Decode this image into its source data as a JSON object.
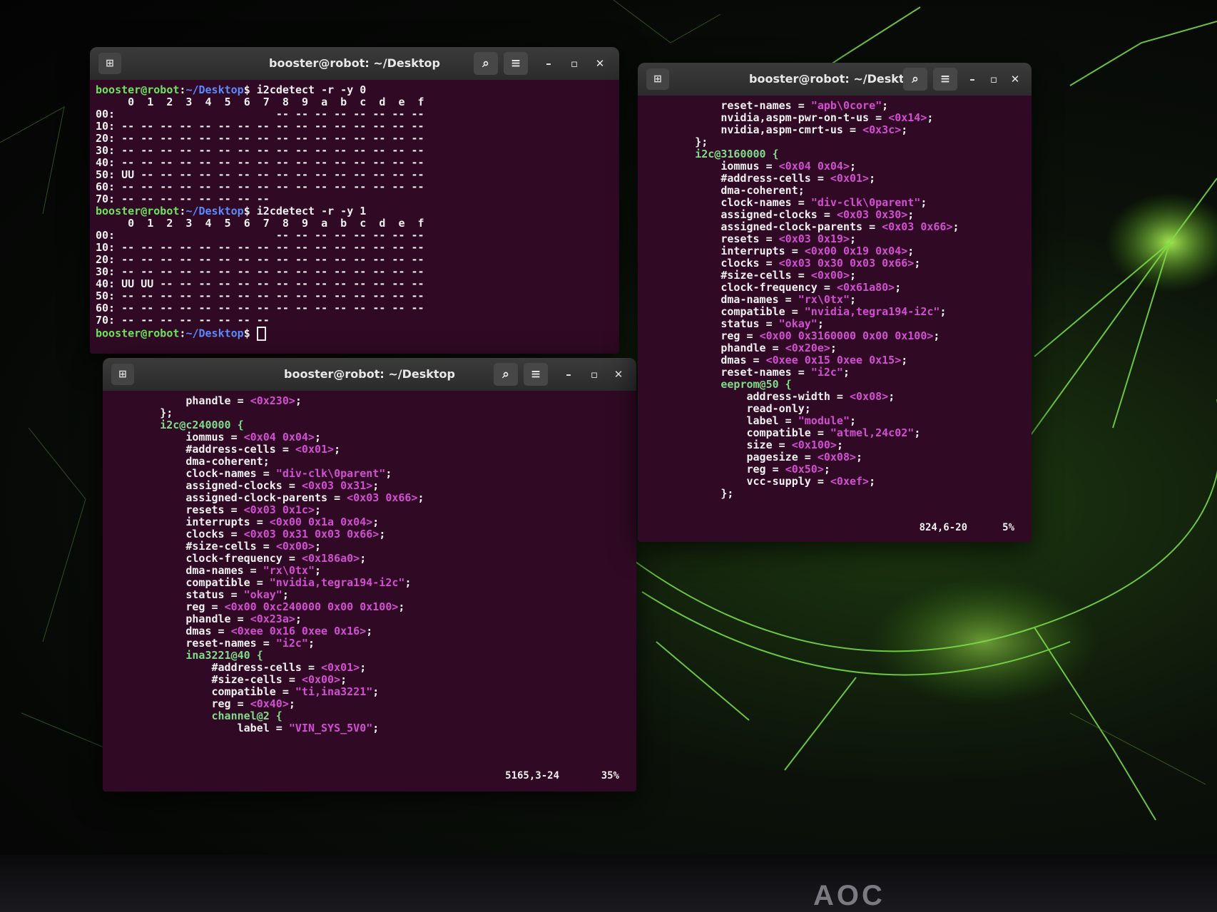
{
  "window_title": "booster@robot: ~/Desktop",
  "prompt": {
    "user": "booster@robot",
    "path": "~/Desktop"
  },
  "term1": {
    "cmd1": "i2cdetect -r -y 0",
    "bus0_lines": [
      "     0  1  2  3  4  5  6  7  8  9  a  b  c  d  e  f",
      "00:                         -- -- -- -- -- -- -- --",
      "10: -- -- -- -- -- -- -- -- -- -- -- -- -- -- -- --",
      "20: -- -- -- -- -- -- -- -- -- -- -- -- -- -- -- --",
      "30: -- -- -- -- -- -- -- -- -- -- -- -- -- -- -- --",
      "40: -- -- -- -- -- -- -- -- -- -- -- -- -- -- -- --",
      "50: UU -- -- -- -- -- -- -- -- -- -- -- -- -- -- --",
      "60: -- -- -- -- -- -- -- -- -- -- -- -- -- -- -- --",
      "70: -- -- -- -- -- -- -- --"
    ],
    "cmd2": "i2cdetect -r -y 1",
    "bus1_lines": [
      "     0  1  2  3  4  5  6  7  8  9  a  b  c  d  e  f",
      "00:                         -- -- -- -- -- -- -- --",
      "10: -- -- -- -- -- -- -- -- -- -- -- -- -- -- -- --",
      "20: -- -- -- -- -- -- -- -- -- -- -- -- -- -- -- --",
      "30: -- -- -- -- -- -- -- -- -- -- -- -- -- -- -- --",
      "40: UU UU -- -- -- -- -- -- -- -- -- -- -- -- -- --",
      "50: -- -- -- -- -- -- -- -- -- -- -- -- -- -- -- --",
      "60: -- -- -- -- -- -- -- -- -- -- -- -- -- -- -- --",
      "70: -- -- -- -- -- -- -- --"
    ]
  },
  "term2": {
    "lines": [
      {
        "i": 6,
        "k": "phandle = ",
        "v": "<0x230>",
        "e": ";"
      },
      {
        "i": 4,
        "k": "};",
        "v": "",
        "e": ""
      },
      {
        "i": 0,
        "k": "",
        "v": "",
        "e": ""
      },
      {
        "i": 4,
        "k": "i2c@c240000 {",
        "v": "",
        "e": "",
        "node": true
      },
      {
        "i": 6,
        "k": "iommus = ",
        "v": "<0x04 0x04>",
        "e": ";"
      },
      {
        "i": 6,
        "k": "#address-cells = ",
        "v": "<0x01>",
        "e": ";"
      },
      {
        "i": 6,
        "k": "dma-coherent;",
        "v": "",
        "e": ""
      },
      {
        "i": 6,
        "k": "clock-names = ",
        "v": "\"div-clk\\0parent\"",
        "e": ";"
      },
      {
        "i": 6,
        "k": "assigned-clocks = ",
        "v": "<0x03 0x31>",
        "e": ";"
      },
      {
        "i": 6,
        "k": "assigned-clock-parents = ",
        "v": "<0x03 0x66>",
        "e": ";"
      },
      {
        "i": 6,
        "k": "resets = ",
        "v": "<0x03 0x1c>",
        "e": ";"
      },
      {
        "i": 6,
        "k": "interrupts = ",
        "v": "<0x00 0x1a 0x04>",
        "e": ";"
      },
      {
        "i": 6,
        "k": "clocks = ",
        "v": "<0x03 0x31 0x03 0x66>",
        "e": ";"
      },
      {
        "i": 6,
        "k": "#size-cells = ",
        "v": "<0x00>",
        "e": ";"
      },
      {
        "i": 6,
        "k": "clock-frequency = ",
        "v": "<0x186a0>",
        "e": ";"
      },
      {
        "i": 6,
        "k": "dma-names = ",
        "v": "\"rx\\0tx\"",
        "e": ";"
      },
      {
        "i": 6,
        "k": "compatible = ",
        "v": "\"nvidia,tegra194-i2c\"",
        "e": ";"
      },
      {
        "i": 6,
        "k": "status = ",
        "v": "\"okay\"",
        "e": ";"
      },
      {
        "i": 6,
        "k": "reg = ",
        "v": "<0x00 0xc240000 0x00 0x100>",
        "e": ";"
      },
      {
        "i": 6,
        "k": "phandle = ",
        "v": "<0x23a>",
        "e": ";"
      },
      {
        "i": 6,
        "k": "dmas = ",
        "v": "<0xee 0x16 0xee 0x16>",
        "e": ";"
      },
      {
        "i": 6,
        "k": "reset-names = ",
        "v": "\"i2c\"",
        "e": ";"
      },
      {
        "i": 0,
        "k": "",
        "v": "",
        "e": ""
      },
      {
        "i": 6,
        "k": "ina3221@40 {",
        "v": "",
        "e": "",
        "node": true
      },
      {
        "i": 8,
        "k": "#address-cells = ",
        "v": "<0x01>",
        "e": ";"
      },
      {
        "i": 8,
        "k": "#size-cells = ",
        "v": "<0x00>",
        "e": ";"
      },
      {
        "i": 8,
        "k": "compatible = ",
        "v": "\"ti,ina3221\"",
        "e": ";"
      },
      {
        "i": 8,
        "k": "reg = ",
        "v": "<0x40>",
        "e": ";"
      },
      {
        "i": 0,
        "k": "",
        "v": "",
        "e": ""
      },
      {
        "i": 8,
        "k": "channel@2 {",
        "v": "",
        "e": "",
        "node": true
      },
      {
        "i": 10,
        "k": "label = ",
        "v": "\"VIN_SYS_5V0\"",
        "e": ";"
      }
    ],
    "status_pos": "5165,3-24",
    "status_pct": "35%"
  },
  "term3": {
    "lines": [
      {
        "i": 6,
        "k": "reset-names = ",
        "v": "\"apb\\0core\"",
        "e": ";"
      },
      {
        "i": 6,
        "k": "nvidia,aspm-pwr-on-t-us = ",
        "v": "<0x14>",
        "e": ";"
      },
      {
        "i": 6,
        "k": "nvidia,aspm-cmrt-us = ",
        "v": "<0x3c>",
        "e": ";"
      },
      {
        "i": 4,
        "k": "};",
        "v": "",
        "e": ""
      },
      {
        "i": 0,
        "k": "",
        "v": "",
        "e": ""
      },
      {
        "i": 4,
        "k": "i2c@3160000 {",
        "v": "",
        "e": "",
        "node": true
      },
      {
        "i": 6,
        "k": "iommus = ",
        "v": "<0x04 0x04>",
        "e": ";"
      },
      {
        "i": 6,
        "k": "#address-cells = ",
        "v": "<0x01>",
        "e": ";"
      },
      {
        "i": 6,
        "k": "dma-coherent;",
        "v": "",
        "e": ""
      },
      {
        "i": 6,
        "k": "clock-names = ",
        "v": "\"div-clk\\0parent\"",
        "e": ";"
      },
      {
        "i": 6,
        "k": "assigned-clocks = ",
        "v": "<0x03 0x30>",
        "e": ";"
      },
      {
        "i": 6,
        "k": "assigned-clock-parents = ",
        "v": "<0x03 0x66>",
        "e": ";"
      },
      {
        "i": 6,
        "k": "resets = ",
        "v": "<0x03 0x19>",
        "e": ";"
      },
      {
        "i": 6,
        "k": "interrupts = ",
        "v": "<0x00 0x19 0x04>",
        "e": ";"
      },
      {
        "i": 6,
        "k": "clocks = ",
        "v": "<0x03 0x30 0x03 0x66>",
        "e": ";"
      },
      {
        "i": 6,
        "k": "#size-cells = ",
        "v": "<0x00>",
        "e": ";"
      },
      {
        "i": 6,
        "k": "clock-frequency = ",
        "v": "<0x61a80>",
        "e": ";"
      },
      {
        "i": 6,
        "k": "dma-names = ",
        "v": "\"rx\\0tx\"",
        "e": ";"
      },
      {
        "i": 6,
        "k": "compatible = ",
        "v": "\"nvidia,tegra194-i2c\"",
        "e": ";"
      },
      {
        "i": 6,
        "k": "status = ",
        "v": "\"okay\"",
        "e": ";"
      },
      {
        "i": 6,
        "k": "reg = ",
        "v": "<0x00 0x3160000 0x00 0x100>",
        "e": ";"
      },
      {
        "i": 6,
        "k": "phandle = ",
        "v": "<0x20e>",
        "e": ";"
      },
      {
        "i": 6,
        "k": "dmas = ",
        "v": "<0xee 0x15 0xee 0x15>",
        "e": ";"
      },
      {
        "i": 6,
        "k": "reset-names = ",
        "v": "\"i2c\"",
        "e": ";"
      },
      {
        "i": 0,
        "k": "",
        "v": "",
        "e": ""
      },
      {
        "i": 6,
        "k": "eeprom@50 {",
        "v": "",
        "e": "",
        "node": true
      },
      {
        "i": 8,
        "k": "address-width = ",
        "v": "<0x08>",
        "e": ";"
      },
      {
        "i": 8,
        "k": "read-only;",
        "v": "",
        "e": ""
      },
      {
        "i": 8,
        "k": "label = ",
        "v": "\"module\"",
        "e": ";"
      },
      {
        "i": 8,
        "k": "compatible = ",
        "v": "\"atmel,24c02\"",
        "e": ";"
      },
      {
        "i": 8,
        "k": "size = ",
        "v": "<0x100>",
        "e": ";"
      },
      {
        "i": 8,
        "k": "pagesize = ",
        "v": "<0x08>",
        "e": ";"
      },
      {
        "i": 8,
        "k": "reg = ",
        "v": "<0x50>",
        "e": ";"
      },
      {
        "i": 8,
        "k": "vcc-supply = ",
        "v": "<0xef>",
        "e": ";"
      },
      {
        "i": 6,
        "k": "};",
        "v": "",
        "e": ""
      }
    ],
    "status_pos": "824,6-20",
    "status_pct": "5%"
  },
  "titlebar_icons": [
    "new-tab-icon",
    "search-icon",
    "hamburger-menu-icon",
    "minimize-icon",
    "maximize-icon",
    "close-icon"
  ],
  "colors": {
    "terminal_bg": "#300a24",
    "prompt_user": "#6fe35a",
    "prompt_path": "#5a8bff",
    "value": "#d14fd1",
    "highlight_mark": "#e21f1f"
  },
  "monitor_brand": "AOC"
}
